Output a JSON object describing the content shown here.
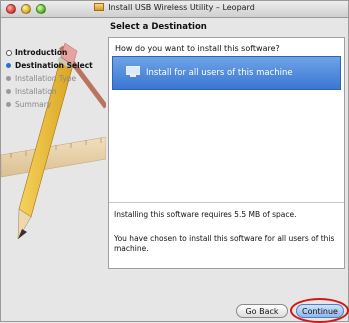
{
  "window": {
    "title": "Install USB Wireless Utility – Leopard"
  },
  "steps": [
    {
      "label": "Introduction"
    },
    {
      "label": "Destination Select"
    },
    {
      "label": "Installation Type"
    },
    {
      "label": "Installation"
    },
    {
      "label": "Summary"
    }
  ],
  "heading": "Select a Destination",
  "question": "How do you want to install this software?",
  "option": {
    "label": "Install for all users of this machine"
  },
  "info": {
    "space": "Installing this software requires 5.5 MB of space.",
    "chosen": "You have chosen to install this software for all users of this machine."
  },
  "buttons": {
    "back": "Go Back",
    "continue": "Continue"
  },
  "colors": {
    "selection": "#3a77d4",
    "highlight_ring": "#d01818"
  },
  "icons": [
    "package-icon",
    "monitor-icon"
  ]
}
